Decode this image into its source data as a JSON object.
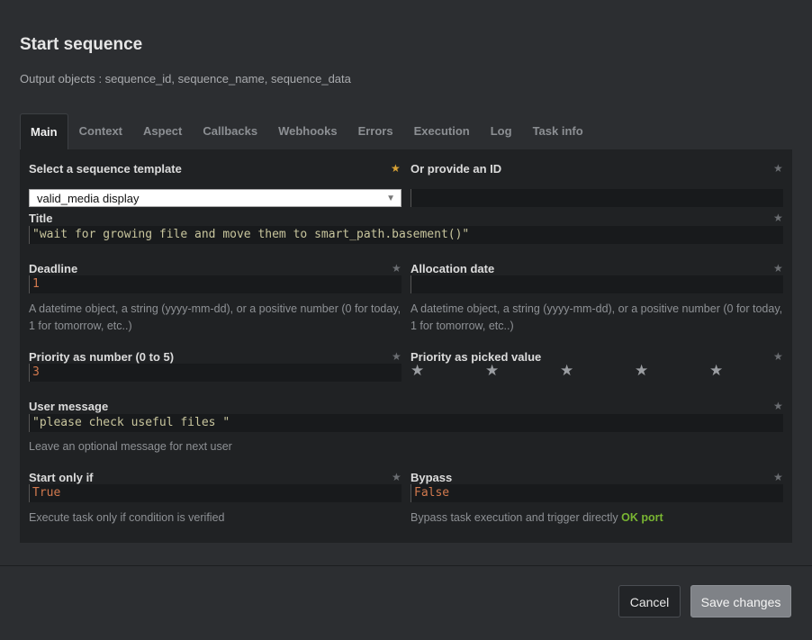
{
  "dialog": {
    "title": "Start sequence",
    "subtitle": "Output objects : sequence_id, sequence_name, sequence_data"
  },
  "tabs": [
    {
      "label": "Main"
    },
    {
      "label": "Context"
    },
    {
      "label": "Aspect"
    },
    {
      "label": "Callbacks"
    },
    {
      "label": "Webhooks"
    },
    {
      "label": "Errors"
    },
    {
      "label": "Execution"
    },
    {
      "label": "Log"
    },
    {
      "label": "Task info"
    }
  ],
  "form": {
    "template": {
      "label": "Select a sequence template",
      "value": "valid_media display"
    },
    "provide_id": {
      "label": "Or provide an ID",
      "value": ""
    },
    "title": {
      "label": "Title",
      "value": "\"wait for growing file and move them to smart_path.basement()\""
    },
    "deadline": {
      "label": "Deadline",
      "value": "1",
      "help": "A datetime object, a string (yyyy-mm-dd), or a positive number (0 for today, 1 for tomorrow, etc..)"
    },
    "allocation": {
      "label": "Allocation date",
      "value": "",
      "help": "A datetime object, a string (yyyy-mm-dd), or a positive number (0 for today, 1 for tomorrow, etc..)"
    },
    "priority_number": {
      "label": "Priority as number (0 to 5)",
      "value": "3"
    },
    "priority_picked": {
      "label": "Priority as picked value",
      "stars": 5,
      "selected": 0
    },
    "user_message": {
      "label": "User message",
      "value": "\"please check useful files \"",
      "help": "Leave an optional message for next user"
    },
    "start_only_if": {
      "label": "Start only if",
      "value": "True",
      "help": "Execute task only if condition is verified"
    },
    "bypass": {
      "label": "Bypass",
      "value": "False",
      "help": "Bypass task execution and trigger directly",
      "help_highlight": "OK port"
    }
  },
  "footer": {
    "cancel_label": "Cancel",
    "save_label": "Save changes"
  },
  "colors": {
    "background": "#2c2e31",
    "panel": "#202224",
    "required_star": "#d8a235",
    "ok_port": "#79b532",
    "code_string": "#c8c59d",
    "code_number": "#d2794e"
  }
}
